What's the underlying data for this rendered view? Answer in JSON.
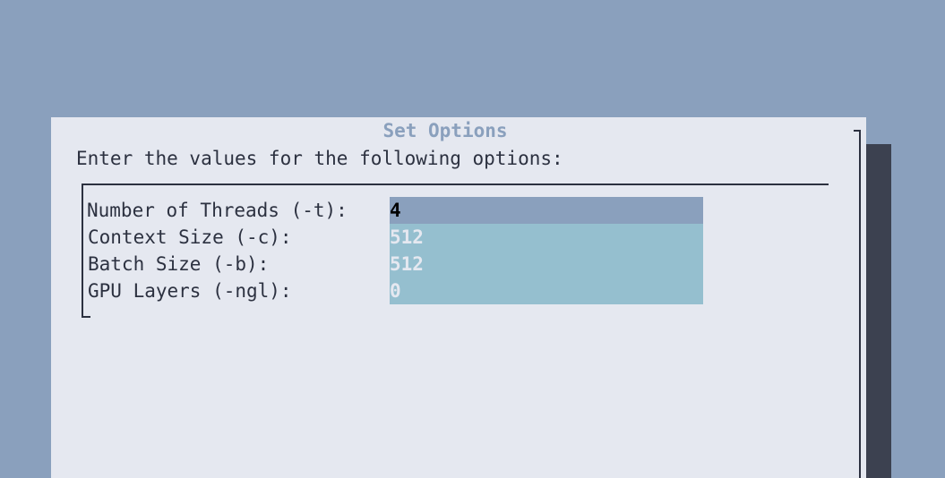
{
  "dialog": {
    "title": "Set Options",
    "prompt": "Enter the values for the following options:"
  },
  "fields": [
    {
      "label": "Number of Threads (-t):",
      "value": "4",
      "focused": true
    },
    {
      "label": "Context Size (-c):",
      "value": "512",
      "focused": false
    },
    {
      "label": "Batch Size (-b):",
      "value": "512",
      "focused": false
    },
    {
      "label": "GPU Layers (-ngl):",
      "value": "0",
      "focused": false
    }
  ],
  "colors": {
    "background": "#8aa0bd",
    "dialog": "#e5e8f0",
    "field": "#95bfcf",
    "field_focused": "#8aa0bd",
    "shadow": "#3c4150",
    "text": "#2c3140"
  }
}
